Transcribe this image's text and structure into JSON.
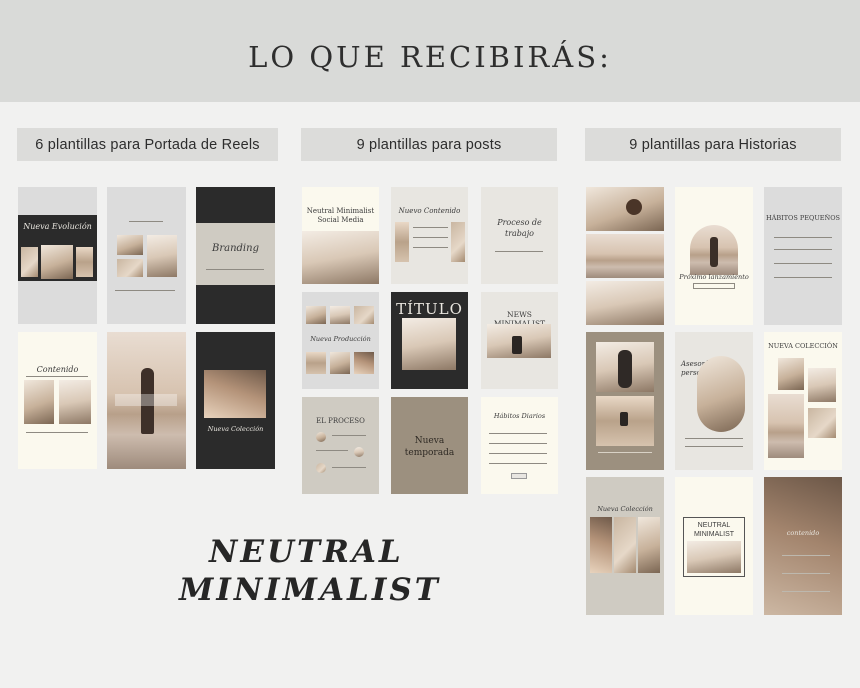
{
  "heading": "LO QUE RECIBIRÁS:",
  "sections": {
    "reels": "6 plantillas para Portada de Reels",
    "posts": "9 plantillas para posts",
    "stories": "9 plantillas para Historias"
  },
  "templates": {
    "nueva_evolucion": "Nueva Evolución",
    "branding": "Branding",
    "contenido": "Contenido",
    "nueva_coleccion": "Nueva Colección",
    "neutral_social": "Neutral Minimalist Social Media",
    "nuevo_contenido": "Nuevo Contenido",
    "proceso_trabajo": "Proceso de trabajo",
    "titulo": "TÍTULO",
    "news_minimalist": "NEWS MINIMALIST",
    "nueva_produccion": "Nueva Producción",
    "el_proceso": "EL PROCESO",
    "nueva_temporada": "Nueva temporada",
    "habitos_diarios": "Hábitos Diarios",
    "habitos_pequenos": "HÁBITOS PEQUEÑOS",
    "prox_lanzamiento": "Próximo lanzamiento",
    "nueva_coleccion_caps": "NUEVA COLECCIÓN",
    "asesorias": "Asesorías personalizadas",
    "nueva_coleccion_story": "Nueva Colección",
    "neutral_minimalist_box": "NEUTRAL MINIMALIST",
    "contenido_story": "contenido"
  },
  "brand_line1": "NEUTRAL",
  "brand_line2": "MINIMALIST"
}
